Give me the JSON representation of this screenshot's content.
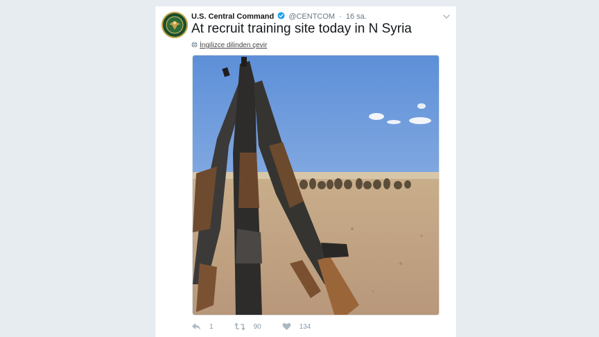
{
  "tweet": {
    "author_name": "U.S. Central Command",
    "author_handle": "@CENTCOM",
    "separator": "·",
    "timestamp": "16 sa.",
    "text": "At recruit training site today in N Syria",
    "translate_label": "İngilizce dilinden çevir",
    "media_alt": "Rifles stacked in foreground with recruits seated on desert ground under blue sky"
  },
  "actions": {
    "reply_count": "1",
    "retweet_count": "90",
    "like_count": "134"
  },
  "colors": {
    "background": "#e6ecf0",
    "card": "#ffffff",
    "verified": "#1da1f2",
    "muted": "#8899a6"
  },
  "icons": {
    "avatar": "centcom-seal-icon",
    "verified": "verified-badge-icon",
    "menu": "chevron-down-icon",
    "translate": "globe-icon",
    "reply": "reply-icon",
    "retweet": "retweet-icon",
    "like": "heart-icon"
  }
}
